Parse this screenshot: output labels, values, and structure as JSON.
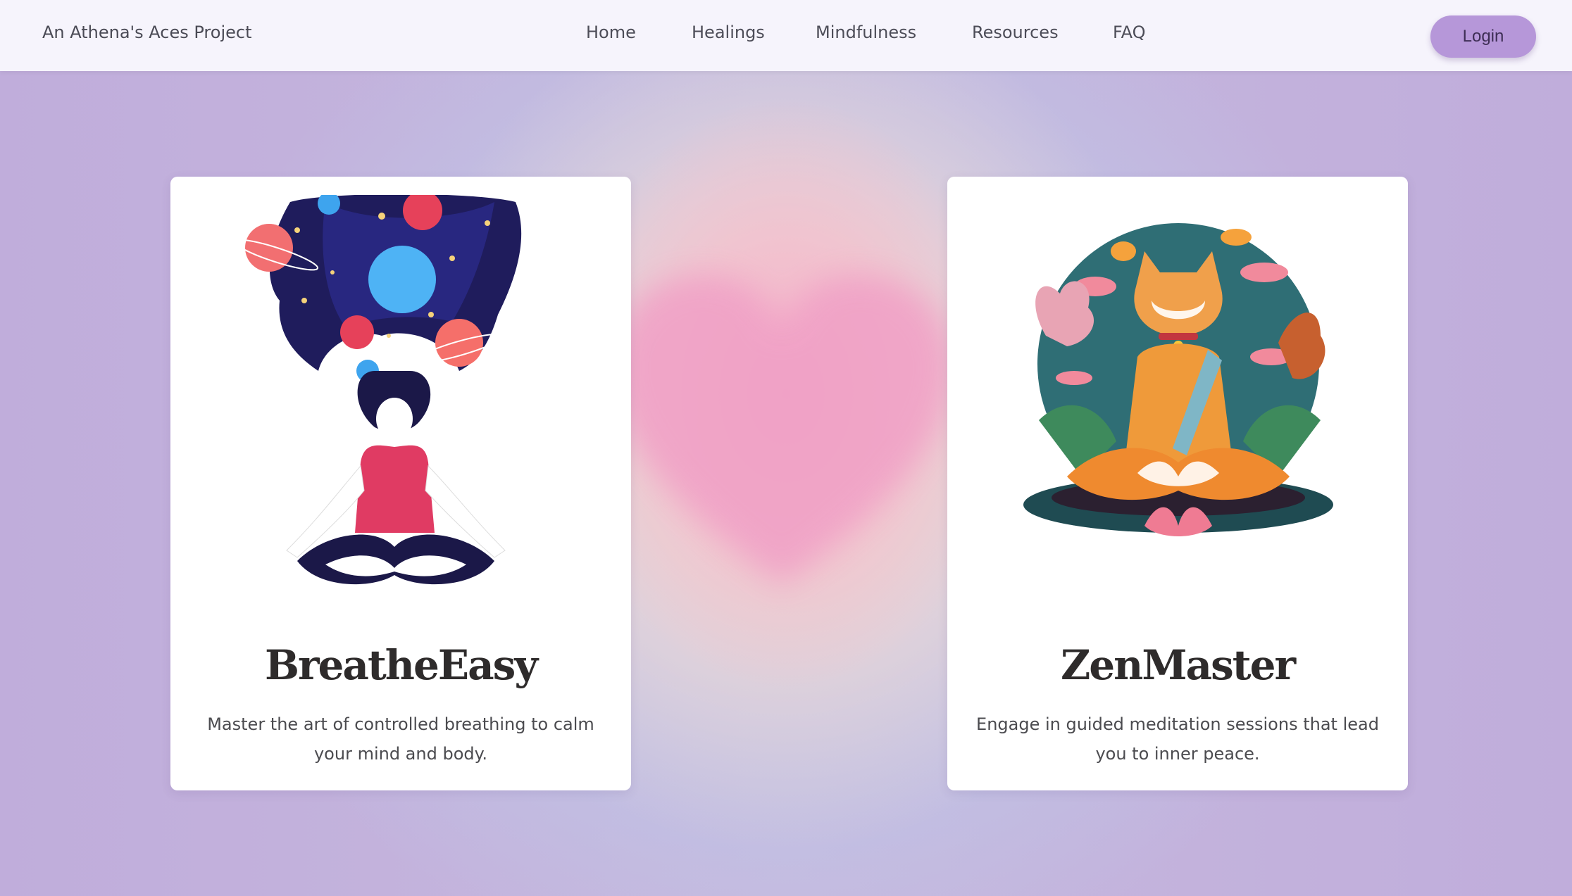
{
  "header": {
    "brand": "An Athena's Aces Project",
    "nav": [
      "Home",
      "Healings",
      "Mindfulness",
      "Resources",
      "FAQ"
    ],
    "login_label": "Login"
  },
  "cards": [
    {
      "title": "BreatheEasy",
      "description": "Master the art of controlled breathing to calm your mind and body.",
      "image": "woman-meditating-cosmic-hair-illustration"
    },
    {
      "title": "ZenMaster",
      "description": "Engage in guided meditation sessions that lead you to inner peace.",
      "image": "cat-meditating-lotus-illustration"
    }
  ],
  "colors": {
    "accent": "#b697d9",
    "background": "#c4b3dc",
    "nav_background": "#f6f4fc"
  }
}
